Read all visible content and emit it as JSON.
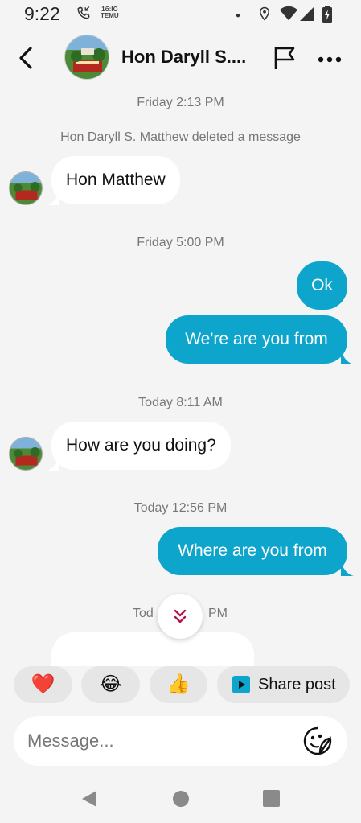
{
  "status_bar": {
    "time": "9:22",
    "temu_label_top": "1б:Ю",
    "temu_label_bottom": "TEMU"
  },
  "header": {
    "contact_name": "Hon Daryll S....",
    "back_icon": "chevron-left-icon",
    "flag_icon": "flag-icon",
    "more_icon": "more-horizontal-icon"
  },
  "chat": {
    "timestamps": [
      "Friday 2:13 PM",
      "Friday 5:00 PM",
      "Today 8:11 AM",
      "Today 12:56 PM",
      "Tod",
      "PM"
    ],
    "system_message": "Hon Daryll S. Matthew deleted a message",
    "messages": [
      {
        "direction": "in",
        "text": "Hon Matthew"
      },
      {
        "direction": "out",
        "text": "Ok"
      },
      {
        "direction": "out",
        "text": "We're are you from"
      },
      {
        "direction": "in",
        "text": "How are you doing?"
      },
      {
        "direction": "out",
        "text": "Where are you from"
      }
    ],
    "colors": {
      "outgoing": "#0ea5cc",
      "incoming": "#ffffff",
      "background": "#f4f4f4"
    }
  },
  "reactions": {
    "heart": "❤️",
    "laugh": "😂",
    "thumbs_up": "👍",
    "share_label": "Share post"
  },
  "composer": {
    "placeholder": "Message..."
  }
}
